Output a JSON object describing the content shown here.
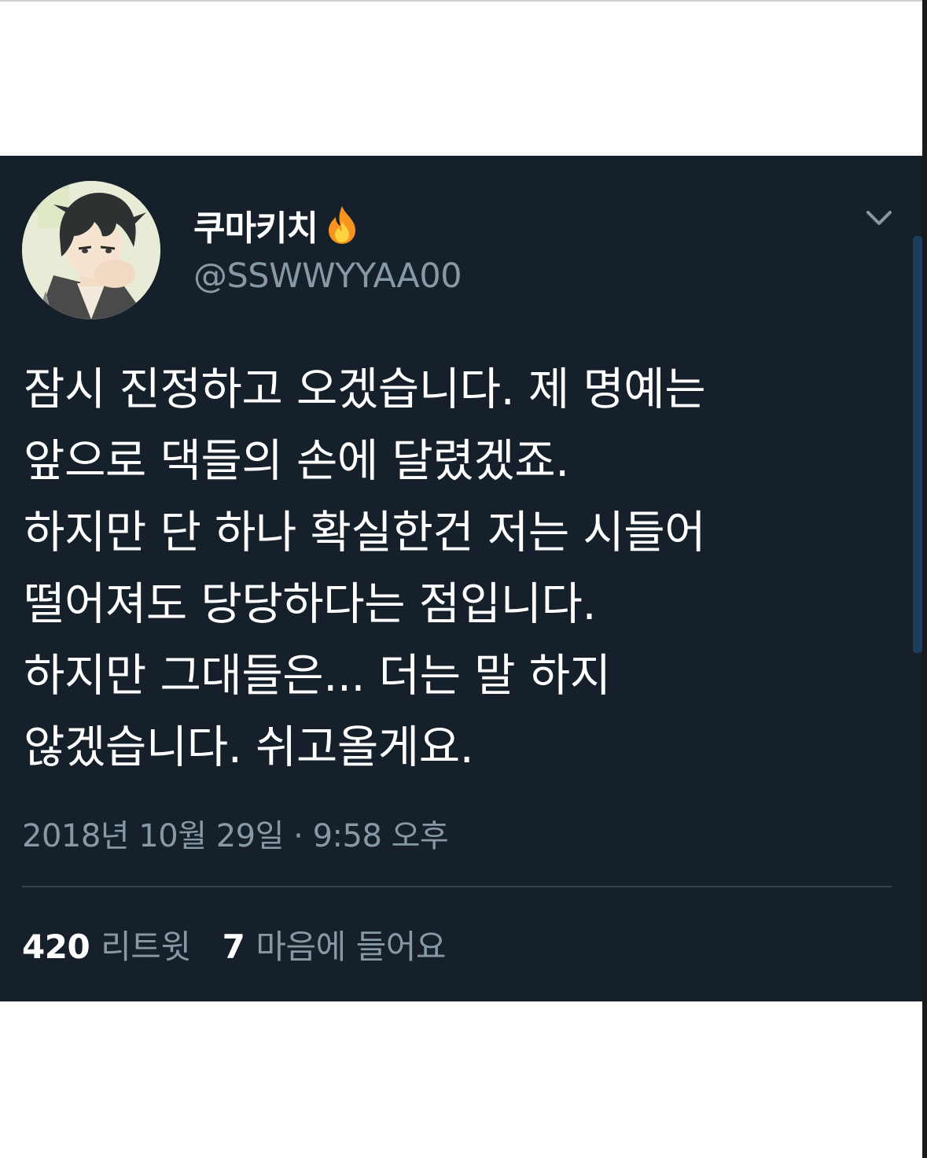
{
  "user": {
    "display_name": "쿠마키치",
    "handle": "@SSWWYYAA00"
  },
  "tweet": {
    "text": "잠시 진정하고 오겠습니다. 제 명예는\n앞으로 댁들의 손에 달렸겠죠.\n하지만 단 하나 확실한건 저는 시들어\n떨어져도 당당하다는 점입니다.\n하지만 그대들은... 더는 말 하지\n않겠습니다. 쉬고올게요.",
    "timestamp": "2018년 10월 29일 · 9:58 오후"
  },
  "stats": {
    "retweets_count": "420",
    "retweets_label": "리트윗",
    "likes_count": "7",
    "likes_label": "마음에 들어요"
  },
  "icons": {
    "name_badge": "fire-icon",
    "menu": "chevron-down-icon"
  },
  "colors": {
    "background": "#15202b",
    "text": "#ffffff",
    "secondary_text": "#8899a6",
    "divider": "#38444d"
  }
}
